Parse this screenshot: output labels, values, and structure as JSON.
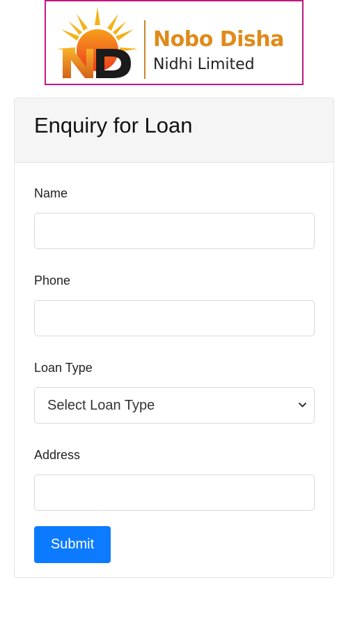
{
  "logo": {
    "brand_line1": "Nobo Disha",
    "brand_line2": "Nidhi Limited",
    "mark_letters": "ND",
    "colors": {
      "border": "#c2187f",
      "sun": "#f4a41b",
      "orange": "#e08a1a",
      "dark": "#1b1b1b"
    }
  },
  "form": {
    "title": "Enquiry for Loan",
    "fields": {
      "name": {
        "label": "Name",
        "value": "",
        "placeholder": ""
      },
      "phone": {
        "label": "Phone",
        "value": "",
        "placeholder": ""
      },
      "loan_type": {
        "label": "Loan Type",
        "selected": "Select Loan Type"
      },
      "address": {
        "label": "Address",
        "value": "",
        "placeholder": ""
      }
    },
    "submit_label": "Submit",
    "colors": {
      "submit_bg": "#0d7bff",
      "header_bg": "#f5f5f5"
    }
  }
}
